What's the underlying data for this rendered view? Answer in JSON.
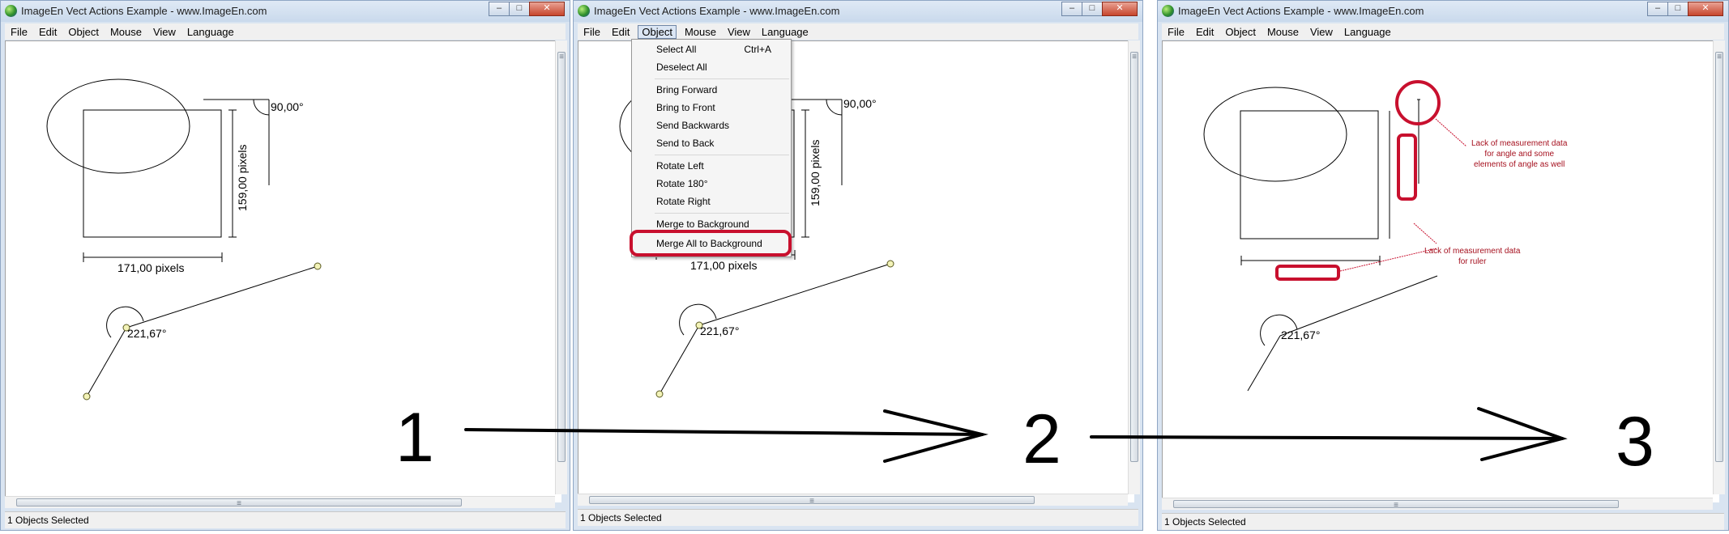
{
  "window": {
    "title": "ImageEn Vect Actions Example - www.ImageEn.com",
    "minimize_glyph": "–",
    "maximize_glyph": "□",
    "close_glyph": "✕"
  },
  "menu": [
    "File",
    "Edit",
    "Object",
    "Mouse",
    "View",
    "Language"
  ],
  "status_text": "1 Objects Selected",
  "measure": {
    "angle_top": "90,00°",
    "vertical": "159,00 pixels",
    "horizontal": "171,00 pixels",
    "angle_bottom": "221,67°"
  },
  "scroll_grip": "≡",
  "object_menu": {
    "items": [
      {
        "label": "Select All",
        "shortcut": "Ctrl+A"
      },
      {
        "label": "Deselect All",
        "shortcut": ""
      },
      {
        "label": "Bring Forward",
        "shortcut": ""
      },
      {
        "label": "Bring to Front",
        "shortcut": ""
      },
      {
        "label": "Send Backwards",
        "shortcut": ""
      },
      {
        "label": "Send to Back",
        "shortcut": ""
      },
      {
        "label": "Rotate Left",
        "shortcut": ""
      },
      {
        "label": "Rotate 180°",
        "shortcut": ""
      },
      {
        "label": "Rotate Right",
        "shortcut": ""
      },
      {
        "label": "Merge to Background",
        "shortcut": ""
      },
      {
        "label": "Merge All to Background",
        "shortcut": ""
      }
    ],
    "highlighted": "Merge All to Background"
  },
  "annotations": {
    "note_angle": [
      "Lack of measurement data",
      "for angle and some",
      "elements of angle as well"
    ],
    "note_ruler": [
      "Lack of measurement data",
      "for ruler"
    ],
    "highlight_color": "#c8102e"
  },
  "steps": [
    "1",
    "2",
    "3"
  ]
}
